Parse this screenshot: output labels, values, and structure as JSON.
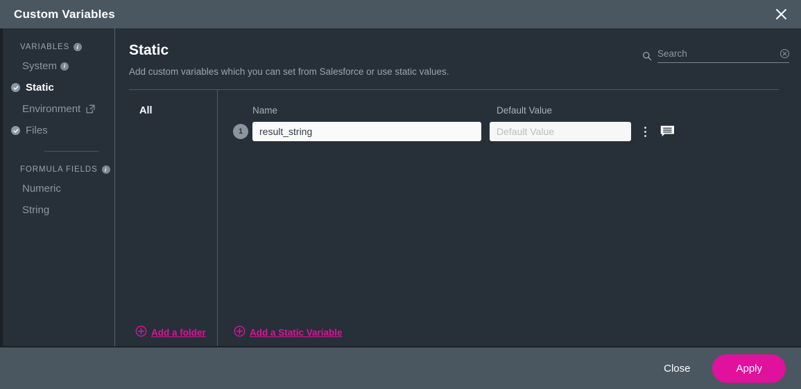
{
  "window": {
    "title": "Custom Variables",
    "close_icon": "close-icon"
  },
  "sidebar": {
    "sections": [
      {
        "label": "VARIABLES",
        "info": "i",
        "items": [
          {
            "label": "System",
            "state": "plain",
            "info": "i"
          },
          {
            "label": "Static",
            "state": "checked",
            "active": true
          },
          {
            "label": "Environment",
            "state": "external"
          },
          {
            "label": "Files",
            "state": "checked"
          }
        ]
      },
      {
        "label": "FORMULA FIELDS",
        "info": "i",
        "items": [
          {
            "label": "Numeric",
            "state": "plain"
          },
          {
            "label": "String",
            "state": "plain"
          }
        ]
      }
    ]
  },
  "main": {
    "title": "Static",
    "subtitle": "Add custom variables which you can set from Salesforce or use static values.",
    "search": {
      "value": "",
      "placeholder": "Search",
      "icon": "search-icon",
      "clear_icon": "clear-circle-icon"
    },
    "folders": {
      "selected": "All",
      "add_folder_label": "Add a folder"
    },
    "columns": {
      "name": "Name",
      "default_value": "Default Value"
    },
    "rows": [
      {
        "number": "1",
        "name": "result_string",
        "default_value": "",
        "default_placeholder": "Default Value",
        "menu_icon": "kebab-menu-icon",
        "comment_icon": "comment-icon"
      }
    ],
    "add_variable_label": "Add a Static Variable"
  },
  "footer": {
    "close_label": "Close",
    "apply_label": "Apply"
  },
  "colors": {
    "accent_pink": "#e0119d",
    "chrome": "#4a5761",
    "panel": "#272f38",
    "muted_text": "#9aa7b0"
  }
}
